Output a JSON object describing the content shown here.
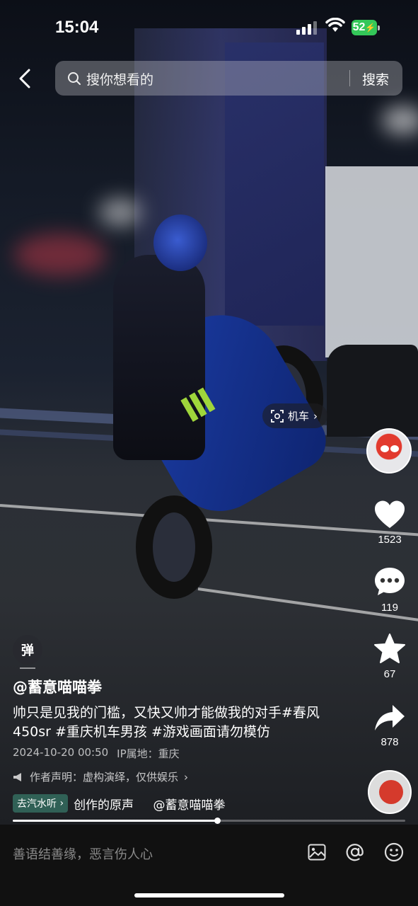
{
  "status_bar": {
    "time": "15:04",
    "battery": "52"
  },
  "search": {
    "placeholder": "搜你想看的",
    "button": "搜索"
  },
  "video_tag": {
    "label": "机车"
  },
  "actions": {
    "likes": "1523",
    "comments": "119",
    "favorites": "67",
    "shares": "878"
  },
  "danmaku_label": "弹",
  "post": {
    "author": "@蓄意喵喵拳",
    "description": "帅只是见我的门槛，又快又帅才能做我的对手#春风450sr #重庆机车男孩 #游戏画面请勿模仿",
    "date": "2024-10-20 00:50",
    "ip": "IP属地：重庆",
    "declaration": "作者声明：虚构演绎，仅供娱乐",
    "music_tag": "去汽水听",
    "music_text": "创作的原声",
    "music_author": "@蓄意喵喵拳"
  },
  "progress": {
    "fraction": 0.52
  },
  "comment_bar": {
    "placeholder": "善语结善缘，恶言伤人心"
  },
  "icons": [
    "back-arrow-icon",
    "search-icon",
    "scan-icon",
    "heart-icon",
    "comment-icon",
    "star-icon",
    "share-icon",
    "image-icon",
    "at-icon",
    "emoji-icon",
    "megaphone-icon"
  ]
}
